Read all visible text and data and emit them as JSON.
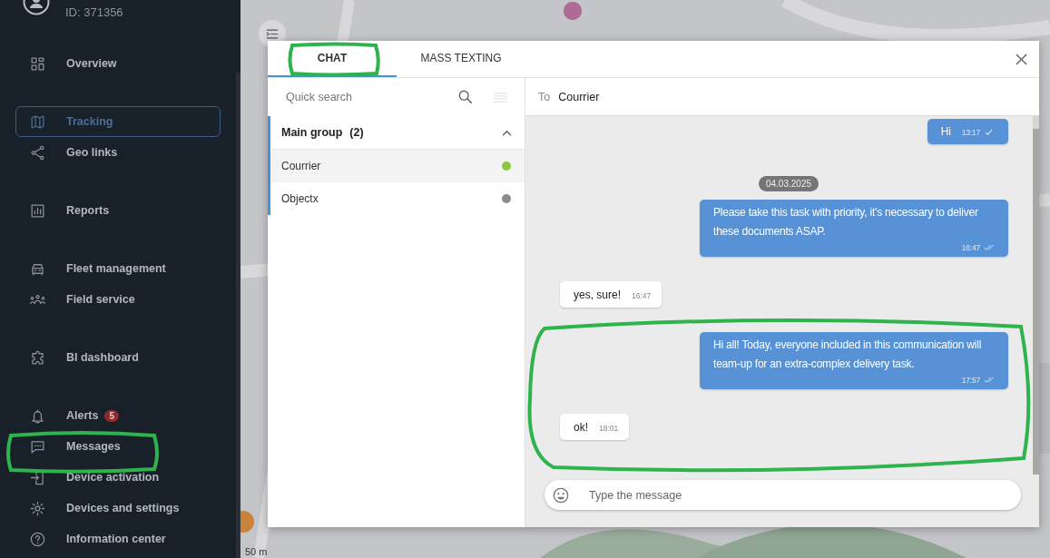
{
  "sidebar": {
    "user_id": "ID: 371356",
    "groups": [
      {
        "items": [
          {
            "label": "Overview",
            "selected": false
          }
        ]
      },
      {
        "items": [
          {
            "label": "Tracking",
            "selected": true
          },
          {
            "label": "Geo links",
            "selected": false
          }
        ]
      },
      {
        "items": [
          {
            "label": "Reports",
            "selected": false
          }
        ]
      },
      {
        "items": [
          {
            "label": "Fleet management",
            "selected": false
          },
          {
            "label": "Field service",
            "selected": false
          }
        ]
      },
      {
        "items": [
          {
            "label": "BI dashboard",
            "selected": false
          }
        ]
      },
      {
        "items": [
          {
            "label": "Alerts",
            "selected": false,
            "badge": "5"
          },
          {
            "label": "Messages",
            "selected": false
          },
          {
            "label": "Device activation",
            "selected": false
          },
          {
            "label": "Devices and settings",
            "selected": false
          },
          {
            "label": "Information center",
            "selected": false
          }
        ]
      }
    ]
  },
  "map": {
    "kind": "picture",
    "scale": "50 m"
  },
  "dialog": {
    "tabs": [
      {
        "label": "CHAT",
        "selected": true
      },
      {
        "label": "MASS TEXTING",
        "selected": false
      }
    ],
    "contacts": {
      "search": {
        "placeholder": "Quick search"
      },
      "groups": [
        {
          "name": "Main group",
          "count": "(2)",
          "expanded": true,
          "children": [
            {
              "name": "Courrier",
              "selected": true,
              "color": "#8dc63f"
            },
            {
              "name": "Objectx",
              "selected": false,
              "color": "#8c8c8c"
            }
          ]
        }
      ]
    },
    "chat": {
      "to_label": "To",
      "recipient": "Courrier",
      "messages": [
        {
          "kind": "outgoing",
          "text": "Hi",
          "time": "13:17",
          "read": false
        },
        {
          "kind": "date",
          "text": "04.03.2025"
        },
        {
          "kind": "outgoing",
          "text": "Please take this task with priority, it's necessary to deliver these documents ASAP.",
          "time": "16:47",
          "read": true
        },
        {
          "kind": "incoming",
          "text": "yes, sure!",
          "time": "16:47"
        },
        {
          "kind": "outgoing",
          "text": "Hi all! Today, everyone included in this communication will team-up for an extra-complex delivery task.",
          "time": "17:57",
          "read": true
        },
        {
          "kind": "incoming",
          "text": "ok!",
          "time": "18:01"
        }
      ],
      "composer": {
        "placeholder": "Type the message"
      }
    }
  }
}
